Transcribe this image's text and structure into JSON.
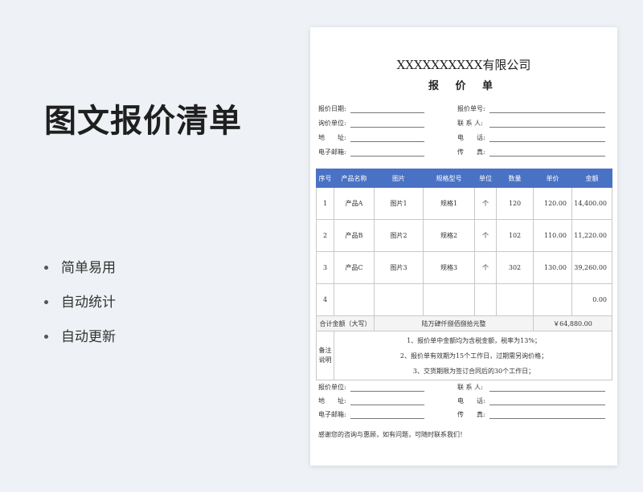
{
  "left": {
    "title": "图文报价清单",
    "features": [
      "简单易用",
      "自动统计",
      "自动更新"
    ]
  },
  "sheet": {
    "company": "XXXXXXXXXX有限公司",
    "title": "报 价 单",
    "header_fields": {
      "date_label": "报价日期:",
      "quote_no_label": "报价单号:",
      "inquiry_unit_label": "询价单位:",
      "contact_label": "联 系 人:",
      "address_label": "地　　址:",
      "phone_label": "电　　话:",
      "email_label": "电子邮箱:",
      "fax_label": "传　　真:"
    },
    "table": {
      "headers": [
        "序号",
        "产品名称",
        "图片",
        "规格型号",
        "单位",
        "数量",
        "单价",
        "金额"
      ],
      "rows": [
        [
          "1",
          "产品A",
          "图片1",
          "规格1",
          "个",
          "120",
          "120.00",
          "14,400.00"
        ],
        [
          "2",
          "产品B",
          "图片2",
          "规格2",
          "个",
          "102",
          "110.00",
          "11,220.00"
        ],
        [
          "3",
          "产品C",
          "图片3",
          "规格3",
          "个",
          "302",
          "130.00",
          "39,260.00"
        ],
        [
          "4",
          "",
          "",
          "",
          "",
          "",
          "",
          "0.00"
        ]
      ],
      "total_label": "合计金额（大写）",
      "total_words": "陆万肆仟捌佰捌拾元整",
      "total_amount": "￥64,880.00",
      "notes_label": "备注说明",
      "notes": [
        "1、报价单中金额均为含税金额，税率为13%；",
        "2、报价单有效期为15个工作日，过期需另询价格；",
        "3、交货期限为签订合同后的30个工作日；"
      ]
    },
    "footer_fields": {
      "quote_unit_label": "报价单位:",
      "contact_label": "联 系 人:",
      "address_label": "地　　址:",
      "phone_label": "电　　话:",
      "email_label": "电子邮箱:",
      "fax_label": "传　　真:"
    },
    "thanks": "感谢您的咨询与惠顾，如有问题，可随时联系我们！"
  }
}
